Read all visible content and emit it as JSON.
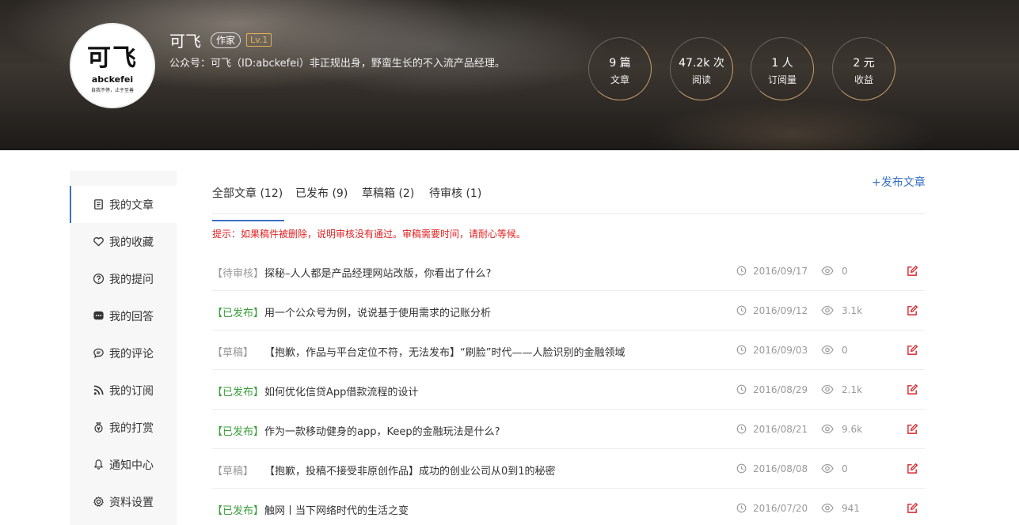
{
  "profile": {
    "name": "可飞",
    "badge_writer": "作家",
    "badge_level": "Lv.1",
    "description": "公众号：可飞（ID:abckefei）非正规出身，野蛮生长的不入流产品经理。",
    "avatar": {
      "main": "可飞",
      "brand": "abckefei",
      "slogan": "自我不停，止于至善"
    }
  },
  "stats": [
    {
      "num": "9 篇",
      "label": "文章"
    },
    {
      "num": "47.2k 次",
      "label": "阅读"
    },
    {
      "num": "1 人",
      "label": "订阅量"
    },
    {
      "num": "2 元",
      "label": "收益"
    }
  ],
  "sidebar": {
    "items": [
      {
        "label": "我的文章",
        "icon": "article-icon"
      },
      {
        "label": "我的收藏",
        "icon": "heart-icon"
      },
      {
        "label": "我的提问",
        "icon": "question-icon"
      },
      {
        "label": "我的回答",
        "icon": "answer-icon"
      },
      {
        "label": "我的评论",
        "icon": "comment-icon"
      },
      {
        "label": "我的订阅",
        "icon": "rss-icon"
      },
      {
        "label": "我的打赏",
        "icon": "reward-icon"
      },
      {
        "label": "通知中心",
        "icon": "bell-icon"
      },
      {
        "label": "资料设置",
        "icon": "gear-icon"
      }
    ]
  },
  "tabs": [
    {
      "label": "全部文章 (12)"
    },
    {
      "label": "已发布 (9)"
    },
    {
      "label": "草稿箱 (2)"
    },
    {
      "label": "待审核 (1)"
    }
  ],
  "publish_label": "+发布文章",
  "hint": "提示：如果稿件被删除，说明审核没有通过。审稿需要时间，请耐心等候。",
  "articles": [
    {
      "status": "【待审核】",
      "title": "探秘–人人都是产品经理网站改版，你看出了什么?",
      "date": "2016/09/17",
      "views": "0"
    },
    {
      "status": "【已发布】",
      "title": "用一个公众号为例，说说基于使用需求的记账分析",
      "date": "2016/09/12",
      "views": "3.1k"
    },
    {
      "status": "【草稿】",
      "title": "【抱歉，作品与平台定位不符，无法发布】“刷脸”时代——人脸识别的金融领域",
      "date": "2016/09/03",
      "views": "0"
    },
    {
      "status": "【已发布】",
      "title": "如何优化信贷App借款流程的设计",
      "date": "2016/08/29",
      "views": "2.1k"
    },
    {
      "status": "【已发布】",
      "title": "作为一款移动健身的app，Keep的金融玩法是什么?",
      "date": "2016/08/21",
      "views": "9.6k"
    },
    {
      "status": "【草稿】",
      "title": "【抱歉，投稿不接受非原创作品】成功的创业公司从0到1的秘密",
      "date": "2016/08/08",
      "views": "0"
    },
    {
      "status": "【已发布】",
      "title": "触网丨当下网络时代的生活之变",
      "date": "2016/07/20",
      "views": "941"
    }
  ]
}
